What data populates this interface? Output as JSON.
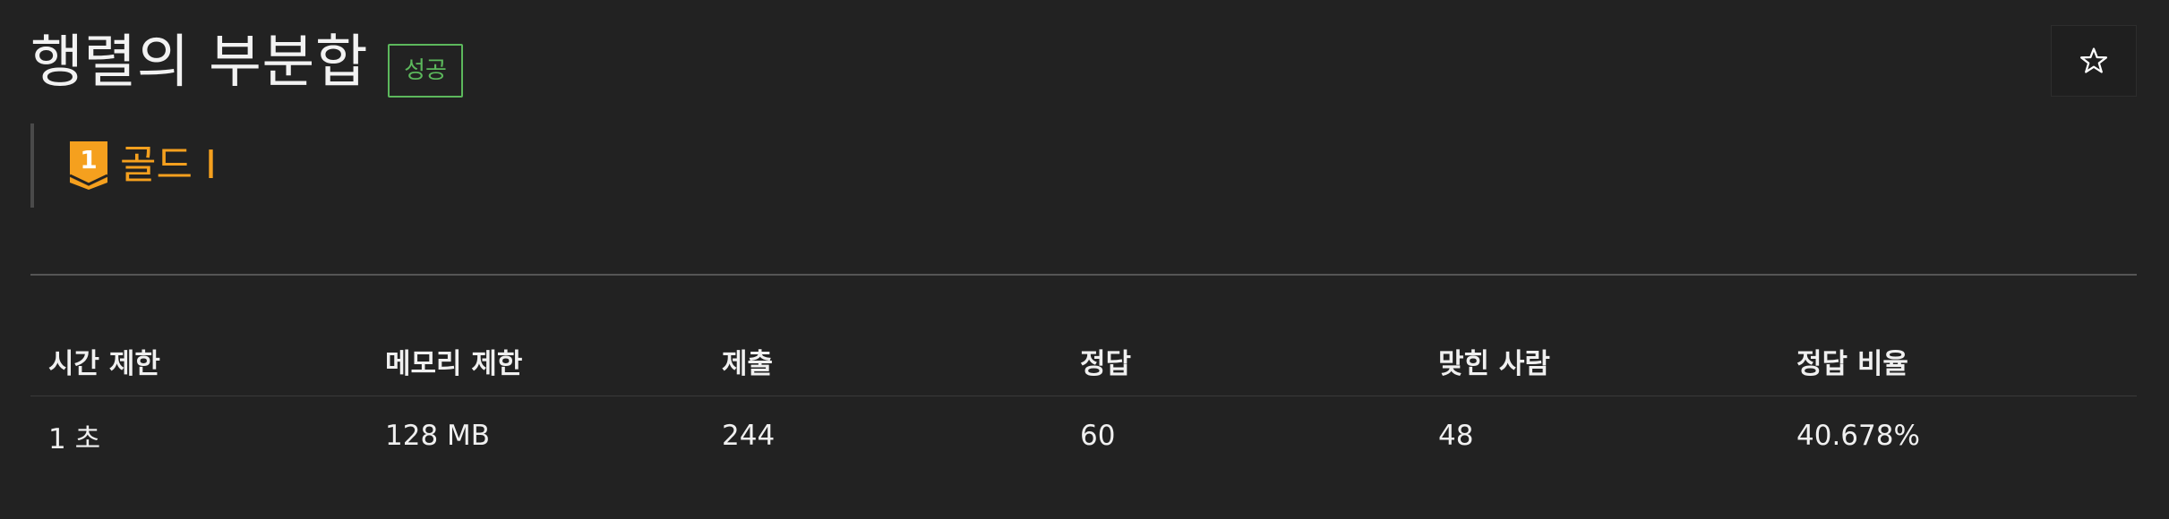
{
  "problem": {
    "title": "행렬의 부분합",
    "status_badge": "성공",
    "tier": {
      "number": "1",
      "label": "골드 I",
      "color": "#f5a01e"
    },
    "favorite_icon": "star-outline-icon"
  },
  "stats": {
    "headers": [
      "시간 제한",
      "메모리 제한",
      "제출",
      "정답",
      "맞힌 사람",
      "정답 비율"
    ],
    "row": [
      "1 초",
      "128 MB",
      "244",
      "60",
      "48",
      "40.678%"
    ]
  },
  "colors": {
    "background": "#222222",
    "success": "#5cb85c",
    "gold": "#f5a01e",
    "text": "#f0f0f0"
  }
}
